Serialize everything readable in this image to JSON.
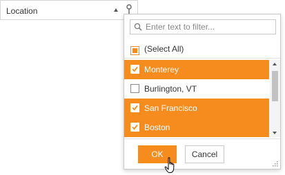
{
  "column_header": {
    "title": "Location",
    "sort_icon": "sort-ascending-icon",
    "filter_icon": "filter-pin-icon"
  },
  "filter_popup": {
    "search": {
      "placeholder": "Enter text to filter...",
      "value": "",
      "icon": "search-icon"
    },
    "select_all": {
      "label": "(Select All)",
      "state": "indeterminate"
    },
    "items": [
      {
        "label": "Monterey",
        "checked": true
      },
      {
        "label": "Burlington, VT",
        "checked": false
      },
      {
        "label": "San Francisco",
        "checked": true
      },
      {
        "label": "Boston",
        "checked": true
      }
    ],
    "buttons": {
      "ok": "OK",
      "cancel": "Cancel"
    }
  },
  "colors": {
    "accent": "#f68c1e",
    "border": "#c8c8c8",
    "text": "#333333"
  }
}
